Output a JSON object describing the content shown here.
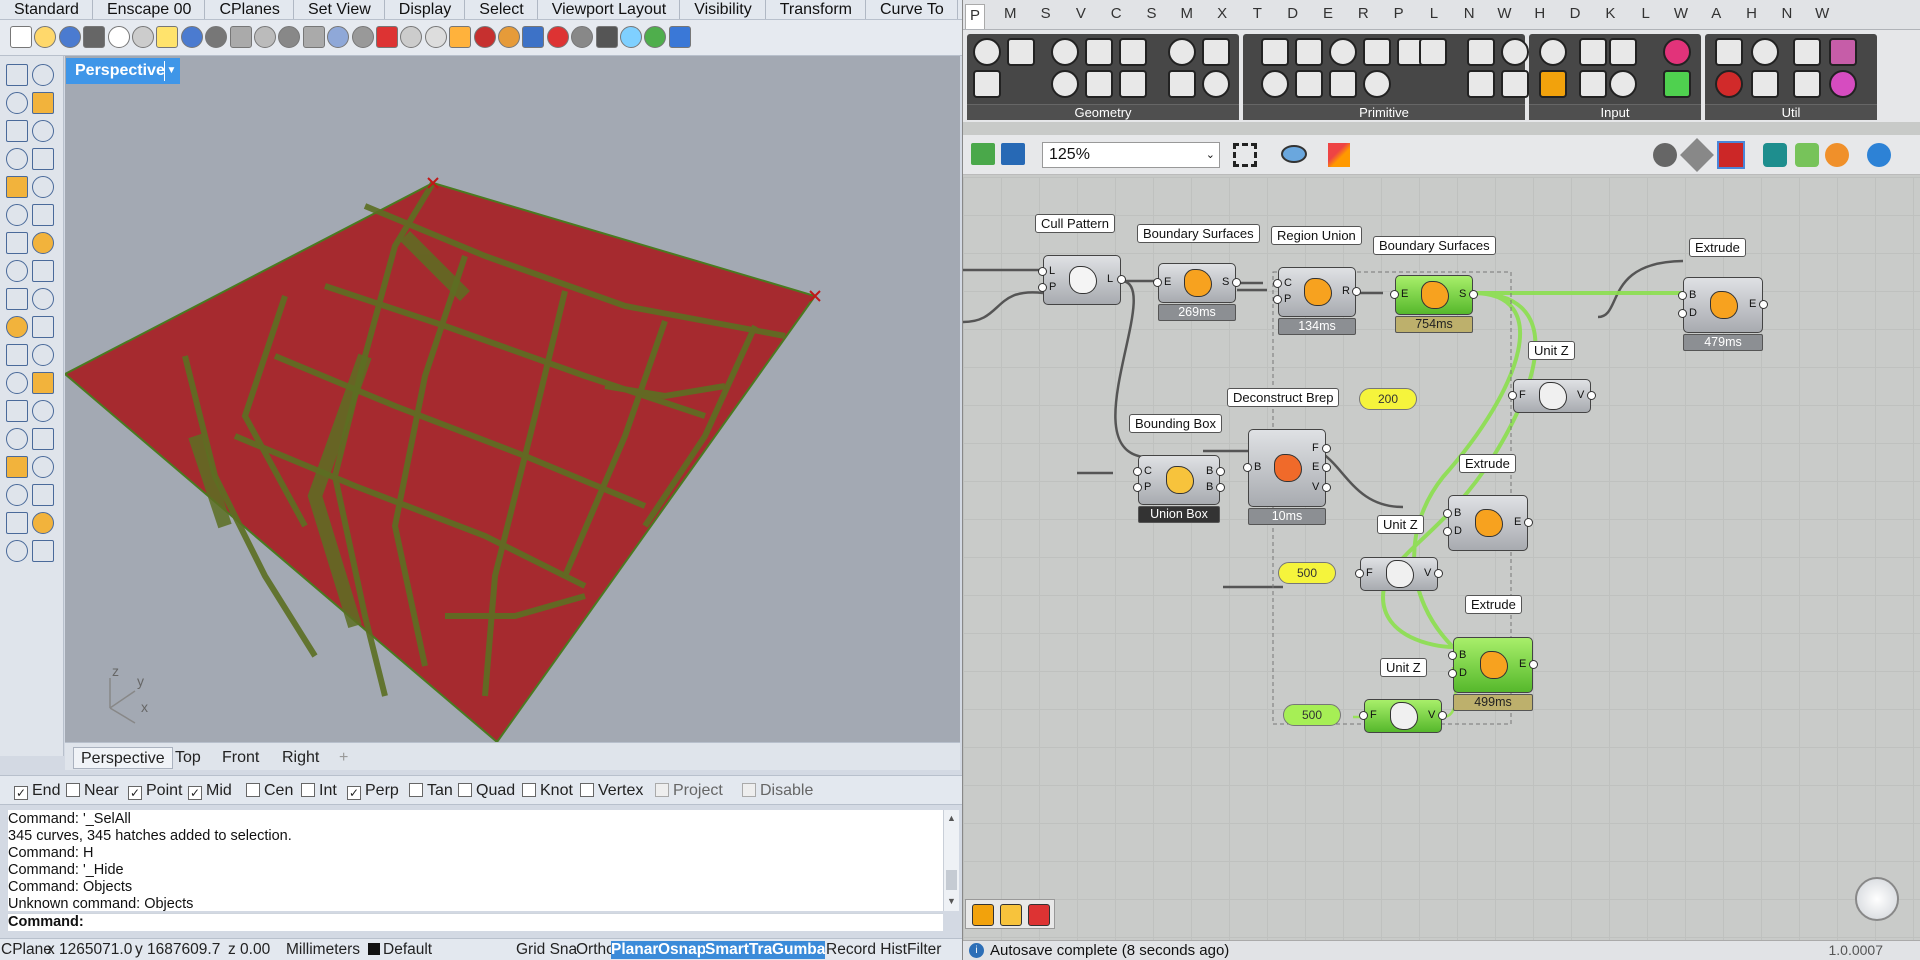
{
  "rhino": {
    "menu": [
      "Standard",
      "Enscape 00",
      "CPlanes",
      "Set View",
      "Display",
      "Select",
      "Viewport Layout",
      "Visibility",
      "Transform",
      "Curve To"
    ],
    "viewport_title": "Perspective",
    "view_tabs": [
      "Perspective",
      "Top",
      "Front",
      "Right"
    ],
    "axis": {
      "z": "z",
      "y": "y",
      "x": "x"
    },
    "osnaps": [
      {
        "label": "End",
        "checked": true
      },
      {
        "label": "Near",
        "checked": false
      },
      {
        "label": "Point",
        "checked": true
      },
      {
        "label": "Mid",
        "checked": true
      },
      {
        "label": "Cen",
        "checked": false
      },
      {
        "label": "Int",
        "checked": false
      },
      {
        "label": "Perp",
        "checked": true
      },
      {
        "label": "Tan",
        "checked": false
      },
      {
        "label": "Quad",
        "checked": false
      },
      {
        "label": "Knot",
        "checked": false
      },
      {
        "label": "Vertex",
        "checked": false
      },
      {
        "label": "Project",
        "checked": false
      },
      {
        "label": "Disable",
        "checked": false
      }
    ],
    "command_history": [
      "Command: '_SelAll",
      "345 curves, 345 hatches added to selection.",
      "Command: H",
      "Command: '_Hide",
      "Command: Objects",
      "Unknown command: Objects"
    ],
    "command_prompt": "Command:",
    "status": {
      "cplane": "CPlane",
      "x": "x 1265071.0",
      "y": "y 1687609.7",
      "z": "z 0.00",
      "units": "Millimeters",
      "layer": "Default",
      "toggles": [
        "Grid Sna",
        "Ortho",
        "Planar",
        "Osnap",
        "SmartTra",
        "Gumba",
        "Record Hist",
        "Filter"
      ],
      "active_toggles": [
        "Planar",
        "Osnap",
        "SmartTra",
        "Gumba"
      ]
    },
    "colors": {
      "hatch": "#a4242a",
      "edge": "#4a7a20",
      "viewport_bg": "#a3a9b3",
      "active_tab": "#3f96e8"
    }
  },
  "grasshopper": {
    "tabs": [
      "P",
      "M",
      "S",
      "V",
      "C",
      "S",
      "M",
      "X",
      "T",
      "D",
      "E",
      "R",
      "P",
      "L",
      "N",
      "W",
      "H",
      "D",
      "K",
      "L",
      "W",
      "A",
      "H",
      "N",
      "W"
    ],
    "ribbon_groups": [
      "Geometry",
      "Primitive",
      "Input",
      "Util"
    ],
    "zoom": "125%",
    "components": {
      "cull_pattern": {
        "label": "Cull Pattern",
        "inputs": [
          "L",
          "P"
        ],
        "outputs": [
          "L"
        ]
      },
      "boundary1": {
        "label": "Boundary Surfaces",
        "inputs": [
          "E"
        ],
        "outputs": [
          "S"
        ],
        "time": "269ms"
      },
      "region_union": {
        "label": "Region Union",
        "inputs": [
          "C",
          "P"
        ],
        "outputs": [
          "R"
        ],
        "time": "134ms"
      },
      "boundary2": {
        "label": "Boundary Surfaces",
        "inputs": [
          "E"
        ],
        "outputs": [
          "S"
        ],
        "time": "754ms"
      },
      "extrude1": {
        "label": "Extrude",
        "inputs": [
          "B",
          "D"
        ],
        "outputs": [
          "E"
        ],
        "time": "479ms"
      },
      "unitz1": {
        "label": "Unit Z",
        "inputs": [
          "F"
        ],
        "outputs": [
          "V"
        ]
      },
      "slider1": {
        "value": "200"
      },
      "bounding_box": {
        "label": "Bounding Box",
        "inputs": [
          "C",
          "P"
        ],
        "outputs": [
          "B",
          "B"
        ],
        "sublabel": "Union Box"
      },
      "deconstruct_brep": {
        "label": "Deconstruct Brep",
        "inputs": [
          "B"
        ],
        "outputs": [
          "F",
          "E",
          "V"
        ],
        "time": "10ms"
      },
      "extrude2": {
        "label": "Extrude",
        "inputs": [
          "B",
          "D"
        ],
        "outputs": [
          "E"
        ]
      },
      "unitz2": {
        "label": "Unit Z",
        "inputs": [
          "F"
        ],
        "outputs": [
          "V"
        ]
      },
      "slider2": {
        "value": "500"
      },
      "extrude3": {
        "label": "Extrude",
        "inputs": [
          "B",
          "D"
        ],
        "outputs": [
          "E"
        ],
        "time": "499ms"
      },
      "unitz3": {
        "label": "Unit Z",
        "inputs": [
          "F"
        ],
        "outputs": [
          "V"
        ]
      },
      "slider3": {
        "value": "500"
      }
    },
    "status_text": "Autosave complete (8 seconds ago)",
    "version": "1.0.0007"
  }
}
